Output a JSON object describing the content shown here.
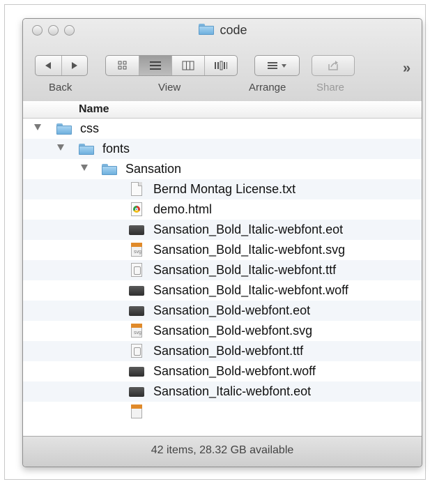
{
  "window": {
    "title": "code"
  },
  "toolbar": {
    "back_label": "Back",
    "view_label": "View",
    "arrange_label": "Arrange",
    "share_label": "Share",
    "more_label": "»"
  },
  "list": {
    "column_header": "Name",
    "rows": [
      {
        "name": "css",
        "icon": "folder-icon"
      },
      {
        "name": "fonts",
        "icon": "folder-icon"
      },
      {
        "name": "Sansation",
        "icon": "folder-icon"
      },
      {
        "name": "Bernd Montag License.txt",
        "icon": "text-file-icon"
      },
      {
        "name": "demo.html",
        "icon": "chrome-html-file-icon"
      },
      {
        "name": "Sansation_Bold_Italic-webfont.eot",
        "icon": "font-file-icon"
      },
      {
        "name": "Sansation_Bold_Italic-webfont.svg",
        "icon": "svg-file-icon"
      },
      {
        "name": "Sansation_Bold_Italic-webfont.ttf",
        "icon": "ttf-file-icon"
      },
      {
        "name": "Sansation_Bold_Italic-webfont.woff",
        "icon": "font-file-icon"
      },
      {
        "name": "Sansation_Bold-webfont.eot",
        "icon": "font-file-icon"
      },
      {
        "name": "Sansation_Bold-webfont.svg",
        "icon": "svg-file-icon"
      },
      {
        "name": "Sansation_Bold-webfont.ttf",
        "icon": "ttf-file-icon"
      },
      {
        "name": "Sansation_Bold-webfont.woff",
        "icon": "font-file-icon"
      },
      {
        "name": "Sansation_Italic-webfont.eot",
        "icon": "font-file-icon"
      }
    ]
  },
  "status": {
    "text": "42 items, 28.32 GB available"
  },
  "colors": {
    "folder_blue": "#6fb0de",
    "svg_orange": "#e08a2a",
    "row_alt": "#f3f6fa"
  }
}
